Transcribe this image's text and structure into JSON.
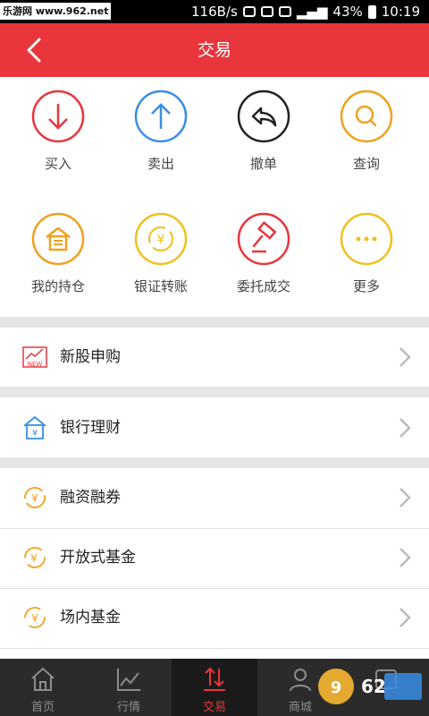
{
  "status_bar": {
    "watermark": "乐游网 www.962.net",
    "speed": "116B/s",
    "battery": "43%",
    "time": "10:19"
  },
  "header": {
    "title": "交易"
  },
  "grid": [
    {
      "label": "买入",
      "icon": "arrow-down-icon",
      "color": "#e8363c"
    },
    {
      "label": "卖出",
      "icon": "arrow-up-icon",
      "color": "#3a8ee6"
    },
    {
      "label": "撤单",
      "icon": "undo-icon",
      "color": "#222222"
    },
    {
      "label": "查询",
      "icon": "search-icon",
      "color": "#f0a020"
    },
    {
      "label": "我的持仓",
      "icon": "warehouse-icon",
      "color": "#f0a020"
    },
    {
      "label": "银证转账",
      "icon": "yuan-transfer-icon",
      "color": "#f0c020"
    },
    {
      "label": "委托成交",
      "icon": "gavel-icon",
      "color": "#e8363c"
    },
    {
      "label": "更多",
      "icon": "more-icon",
      "color": "#f0c020"
    }
  ],
  "menu": [
    {
      "label": "新股申购",
      "icon": "new-stock-icon"
    },
    {
      "label": "银行理财",
      "icon": "bank-icon"
    },
    {
      "label": "融资融券",
      "icon": "margin-yuan-icon"
    },
    {
      "label": "开放式基金",
      "icon": "open-fund-icon"
    },
    {
      "label": "场内基金",
      "icon": "exchange-fund-icon"
    }
  ],
  "tabs": [
    {
      "label": "首页",
      "icon": "home-icon"
    },
    {
      "label": "行情",
      "icon": "chart-icon"
    },
    {
      "label": "交易",
      "icon": "trade-icon",
      "active": true
    },
    {
      "label": "商城",
      "icon": "person-icon"
    },
    {
      "label": "",
      "icon": "more-tab-icon"
    }
  ],
  "colors": {
    "accent": "#e8363c",
    "tab_bg": "#2b2b2b"
  }
}
